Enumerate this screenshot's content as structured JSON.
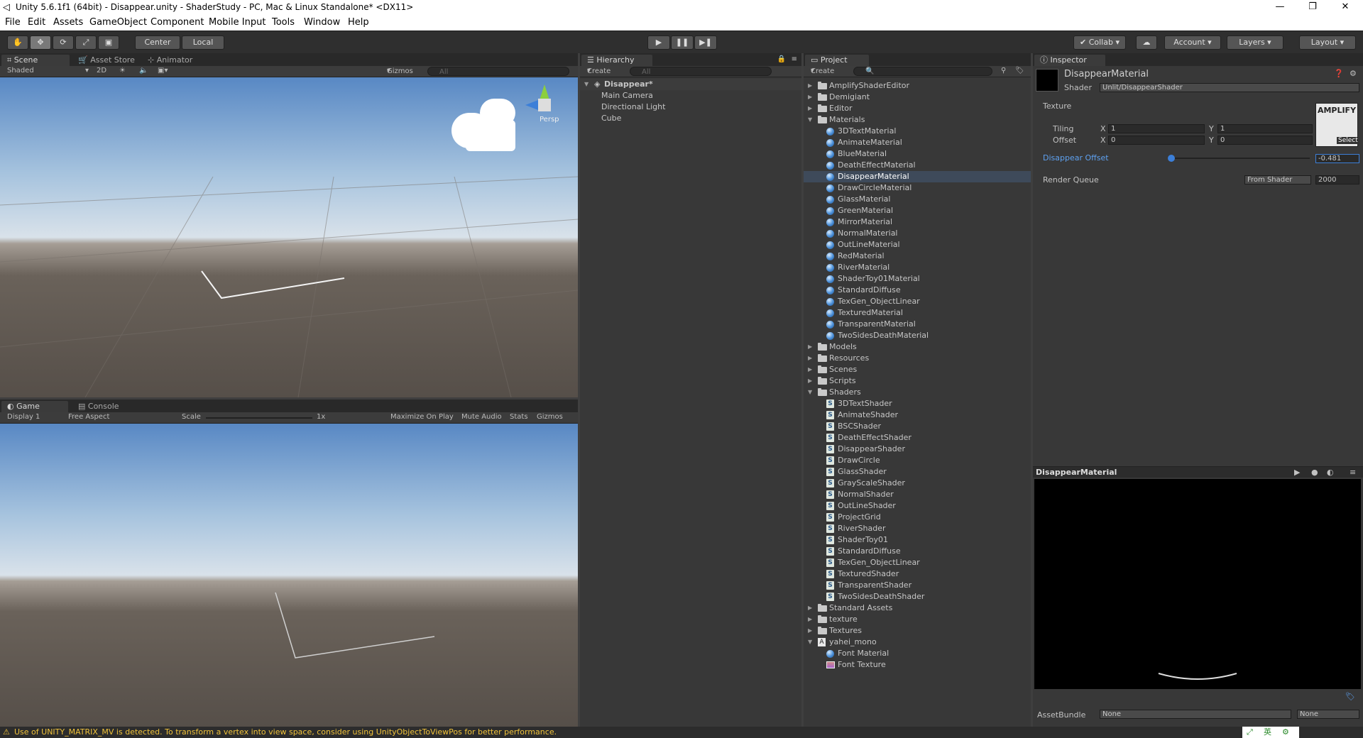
{
  "window": {
    "title": "Unity 5.6.1f1 (64bit) - Disappear.unity - ShaderStudy - PC, Mac & Linux Standalone* <DX11>"
  },
  "menu": [
    "File",
    "Edit",
    "Assets",
    "GameObject",
    "Component",
    "Mobile Input",
    "Tools",
    "Window",
    "Help"
  ],
  "toolbar": {
    "pivot": "Center",
    "space": "Local",
    "collab": "Collab",
    "account": "Account",
    "layers": "Layers",
    "layout": "Layout"
  },
  "scene": {
    "tabs": [
      "Scene",
      "Asset Store",
      "Animator"
    ],
    "shading": "Shaded",
    "mode2d": "2D",
    "gizmos": "Gizmos",
    "search": "All",
    "persp": "Persp"
  },
  "game": {
    "tabs": [
      "Game",
      "Console"
    ],
    "display": "Display 1",
    "aspect": "Free Aspect",
    "scale_label": "Scale",
    "scale_value": "1x",
    "maximize": "Maximize On Play",
    "mute": "Mute Audio",
    "stats": "Stats",
    "gizmos": "Gizmos"
  },
  "hierarchy": {
    "title": "Hierarchy",
    "create": "Create",
    "search": "All",
    "scene": "Disappear*",
    "items": [
      "Main Camera",
      "Directional Light",
      "Cube"
    ]
  },
  "project": {
    "title": "Project",
    "create": "Create",
    "rows": [
      {
        "depth": 0,
        "kind": "folder",
        "label": "AmplifyShaderEditor",
        "open": false
      },
      {
        "depth": 0,
        "kind": "folder",
        "label": "Demigiant",
        "open": false
      },
      {
        "depth": 0,
        "kind": "folder",
        "label": "Editor",
        "open": false
      },
      {
        "depth": 0,
        "kind": "folder",
        "label": "Materials",
        "open": true
      },
      {
        "depth": 1,
        "kind": "material",
        "label": "3DTextMaterial"
      },
      {
        "depth": 1,
        "kind": "material",
        "label": "AnimateMaterial"
      },
      {
        "depth": 1,
        "kind": "material",
        "label": "BlueMaterial"
      },
      {
        "depth": 1,
        "kind": "material",
        "label": "DeathEffectMaterial"
      },
      {
        "depth": 1,
        "kind": "material",
        "label": "DisappearMaterial",
        "selected": true
      },
      {
        "depth": 1,
        "kind": "material",
        "label": "DrawCircleMaterial"
      },
      {
        "depth": 1,
        "kind": "material",
        "label": "GlassMaterial"
      },
      {
        "depth": 1,
        "kind": "material",
        "label": "GreenMaterial"
      },
      {
        "depth": 1,
        "kind": "material",
        "label": "MirrorMaterial"
      },
      {
        "depth": 1,
        "kind": "material",
        "label": "NormalMaterial"
      },
      {
        "depth": 1,
        "kind": "material",
        "label": "OutLineMaterial"
      },
      {
        "depth": 1,
        "kind": "material",
        "label": "RedMaterial"
      },
      {
        "depth": 1,
        "kind": "material",
        "label": "RiverMaterial"
      },
      {
        "depth": 1,
        "kind": "material",
        "label": "ShaderToy01Material"
      },
      {
        "depth": 1,
        "kind": "material",
        "label": "StandardDiffuse"
      },
      {
        "depth": 1,
        "kind": "material",
        "label": "TexGen_ObjectLinear"
      },
      {
        "depth": 1,
        "kind": "material",
        "label": "TexturedMaterial"
      },
      {
        "depth": 1,
        "kind": "material",
        "label": "TransparentMaterial"
      },
      {
        "depth": 1,
        "kind": "material",
        "label": "TwoSidesDeathMaterial"
      },
      {
        "depth": 0,
        "kind": "folder",
        "label": "Models",
        "open": false
      },
      {
        "depth": 0,
        "kind": "folder",
        "label": "Resources",
        "open": false
      },
      {
        "depth": 0,
        "kind": "folder",
        "label": "Scenes",
        "open": false
      },
      {
        "depth": 0,
        "kind": "folder",
        "label": "Scripts",
        "open": false
      },
      {
        "depth": 0,
        "kind": "folder",
        "label": "Shaders",
        "open": true
      },
      {
        "depth": 1,
        "kind": "shader",
        "label": "3DTextShader"
      },
      {
        "depth": 1,
        "kind": "shader",
        "label": "AnimateShader"
      },
      {
        "depth": 1,
        "kind": "shader",
        "label": "BSCShader"
      },
      {
        "depth": 1,
        "kind": "shader",
        "label": "DeathEffectShader"
      },
      {
        "depth": 1,
        "kind": "shader",
        "label": "DisappearShader"
      },
      {
        "depth": 1,
        "kind": "shader",
        "label": "DrawCircle"
      },
      {
        "depth": 1,
        "kind": "shader",
        "label": "GlassShader"
      },
      {
        "depth": 1,
        "kind": "shader",
        "label": "GrayScaleShader"
      },
      {
        "depth": 1,
        "kind": "shader",
        "label": "NormalShader"
      },
      {
        "depth": 1,
        "kind": "shader",
        "label": "OutLineShader"
      },
      {
        "depth": 1,
        "kind": "shader",
        "label": "ProjectGrid"
      },
      {
        "depth": 1,
        "kind": "shader",
        "label": "RiverShader"
      },
      {
        "depth": 1,
        "kind": "shader",
        "label": "ShaderToy01"
      },
      {
        "depth": 1,
        "kind": "shader",
        "label": "StandardDiffuse"
      },
      {
        "depth": 1,
        "kind": "shader",
        "label": "TexGen_ObjectLinear"
      },
      {
        "depth": 1,
        "kind": "shader",
        "label": "TexturedShader"
      },
      {
        "depth": 1,
        "kind": "shader",
        "label": "TransparentShader"
      },
      {
        "depth": 1,
        "kind": "shader",
        "label": "TwoSidesDeathShader"
      },
      {
        "depth": 0,
        "kind": "folder",
        "label": "Standard Assets",
        "open": false
      },
      {
        "depth": 0,
        "kind": "folder",
        "label": "texture",
        "open": false
      },
      {
        "depth": 0,
        "kind": "folder",
        "label": "Textures",
        "open": false
      },
      {
        "depth": 0,
        "kind": "font",
        "label": "yahei_mono",
        "open": true
      },
      {
        "depth": 1,
        "kind": "material",
        "label": "Font Material"
      },
      {
        "depth": 1,
        "kind": "texture",
        "label": "Font Texture"
      }
    ]
  },
  "inspector": {
    "title": "Inspector",
    "material_name": "DisappearMaterial",
    "shader_label": "Shader",
    "shader_value": "Unlit/DisappearShader",
    "texture_label": "Texture",
    "tiling_label": "Tiling",
    "offset_label": "Offset",
    "tiling_x": "1",
    "tiling_y": "1",
    "offset_x": "0",
    "offset_y": "0",
    "x": "X",
    "y": "Y",
    "thumb_text": "AMPLIFY",
    "select": "Select",
    "disappear_label": "Disappear Offset",
    "disappear_value": "-0.481",
    "disappear_fraction": 0.0,
    "render_queue_label": "Render Queue",
    "render_queue_mode": "From Shader",
    "render_queue_value": "2000",
    "preview_title": "DisappearMaterial",
    "assetbundle_label": "AssetBundle",
    "assetbundle_value": "None",
    "assetbundle_variant": "None"
  },
  "status": {
    "message": "Use of UNITY_MATRIX_MV is detected. To transform a vertex into view space, consider using UnityObjectToViewPos for better performance."
  },
  "tray": {
    "ime": "英"
  }
}
